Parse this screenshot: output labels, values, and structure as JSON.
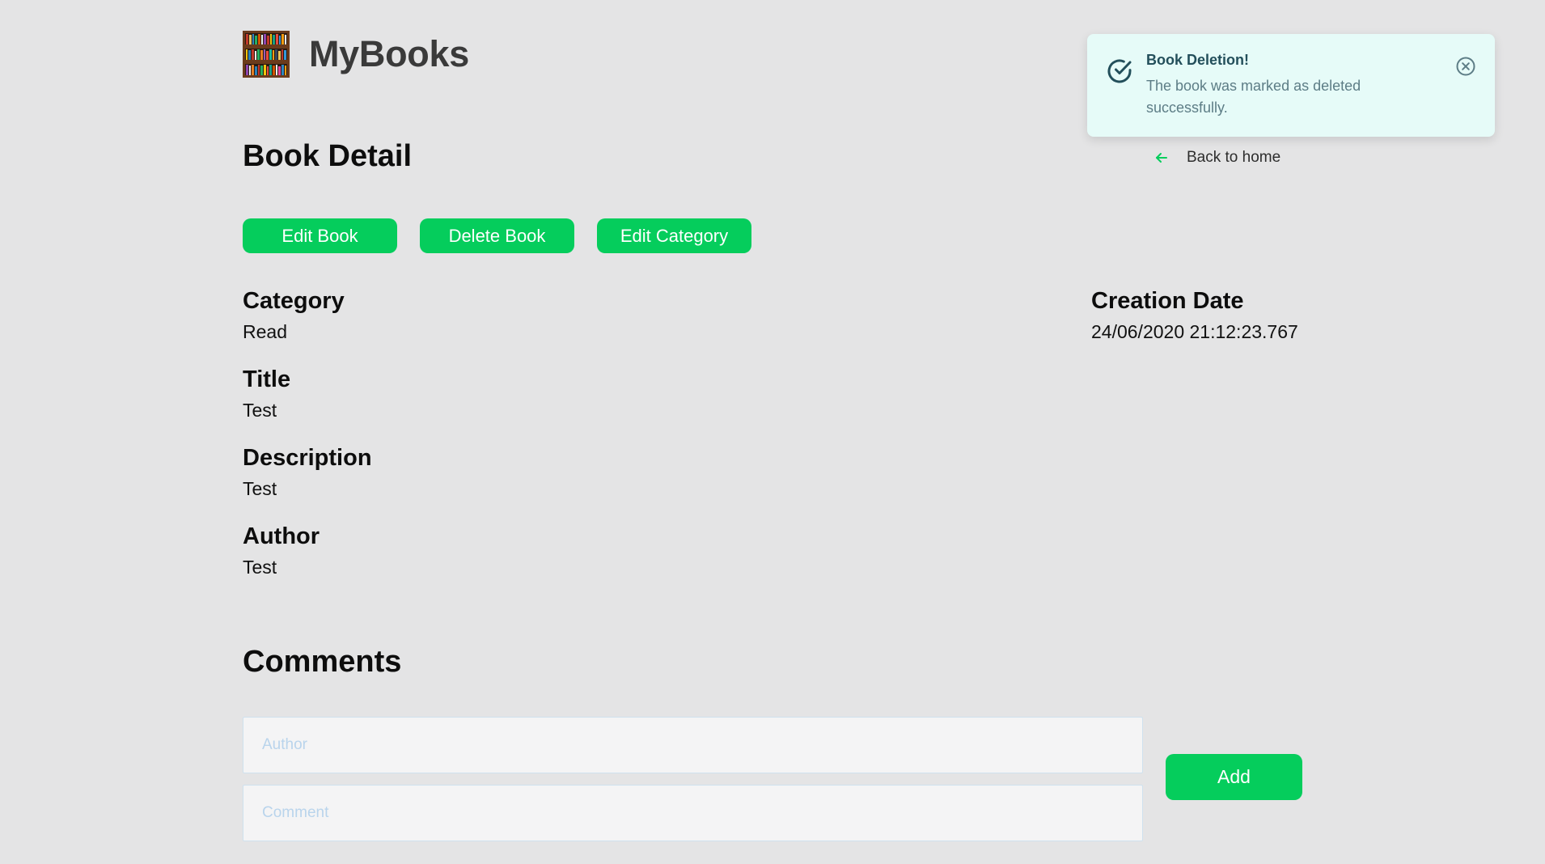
{
  "header": {
    "brand": "MyBooks",
    "logo_icon": "bookshelf-icon"
  },
  "page": {
    "title": "Book Detail"
  },
  "actions": {
    "edit_book": "Edit Book",
    "delete_book": "Delete Book",
    "edit_category": "Edit Category"
  },
  "details": {
    "category": {
      "label": "Category",
      "value": "Read"
    },
    "title": {
      "label": "Title",
      "value": "Test"
    },
    "description": {
      "label": "Description",
      "value": "Test"
    },
    "author": {
      "label": "Author",
      "value": "Test"
    },
    "creation_date": {
      "label": "Creation Date",
      "value": "24/06/2020 21:12:23.767"
    }
  },
  "comments": {
    "title": "Comments",
    "author_placeholder": "Author",
    "comment_placeholder": "Comment",
    "add_label": "Add"
  },
  "toast": {
    "title": "Book Deletion!",
    "message": "The book was marked as deleted successfully.",
    "icon": "check-circle-icon",
    "close_icon": "close-circle-icon"
  },
  "nav": {
    "back_label": "Back to home",
    "back_icon": "arrow-left-icon"
  },
  "colors": {
    "accent": "#05cd5c",
    "background": "#e4e4e5",
    "toast_background": "#e6fbf8",
    "toast_title": "#234f5b"
  }
}
